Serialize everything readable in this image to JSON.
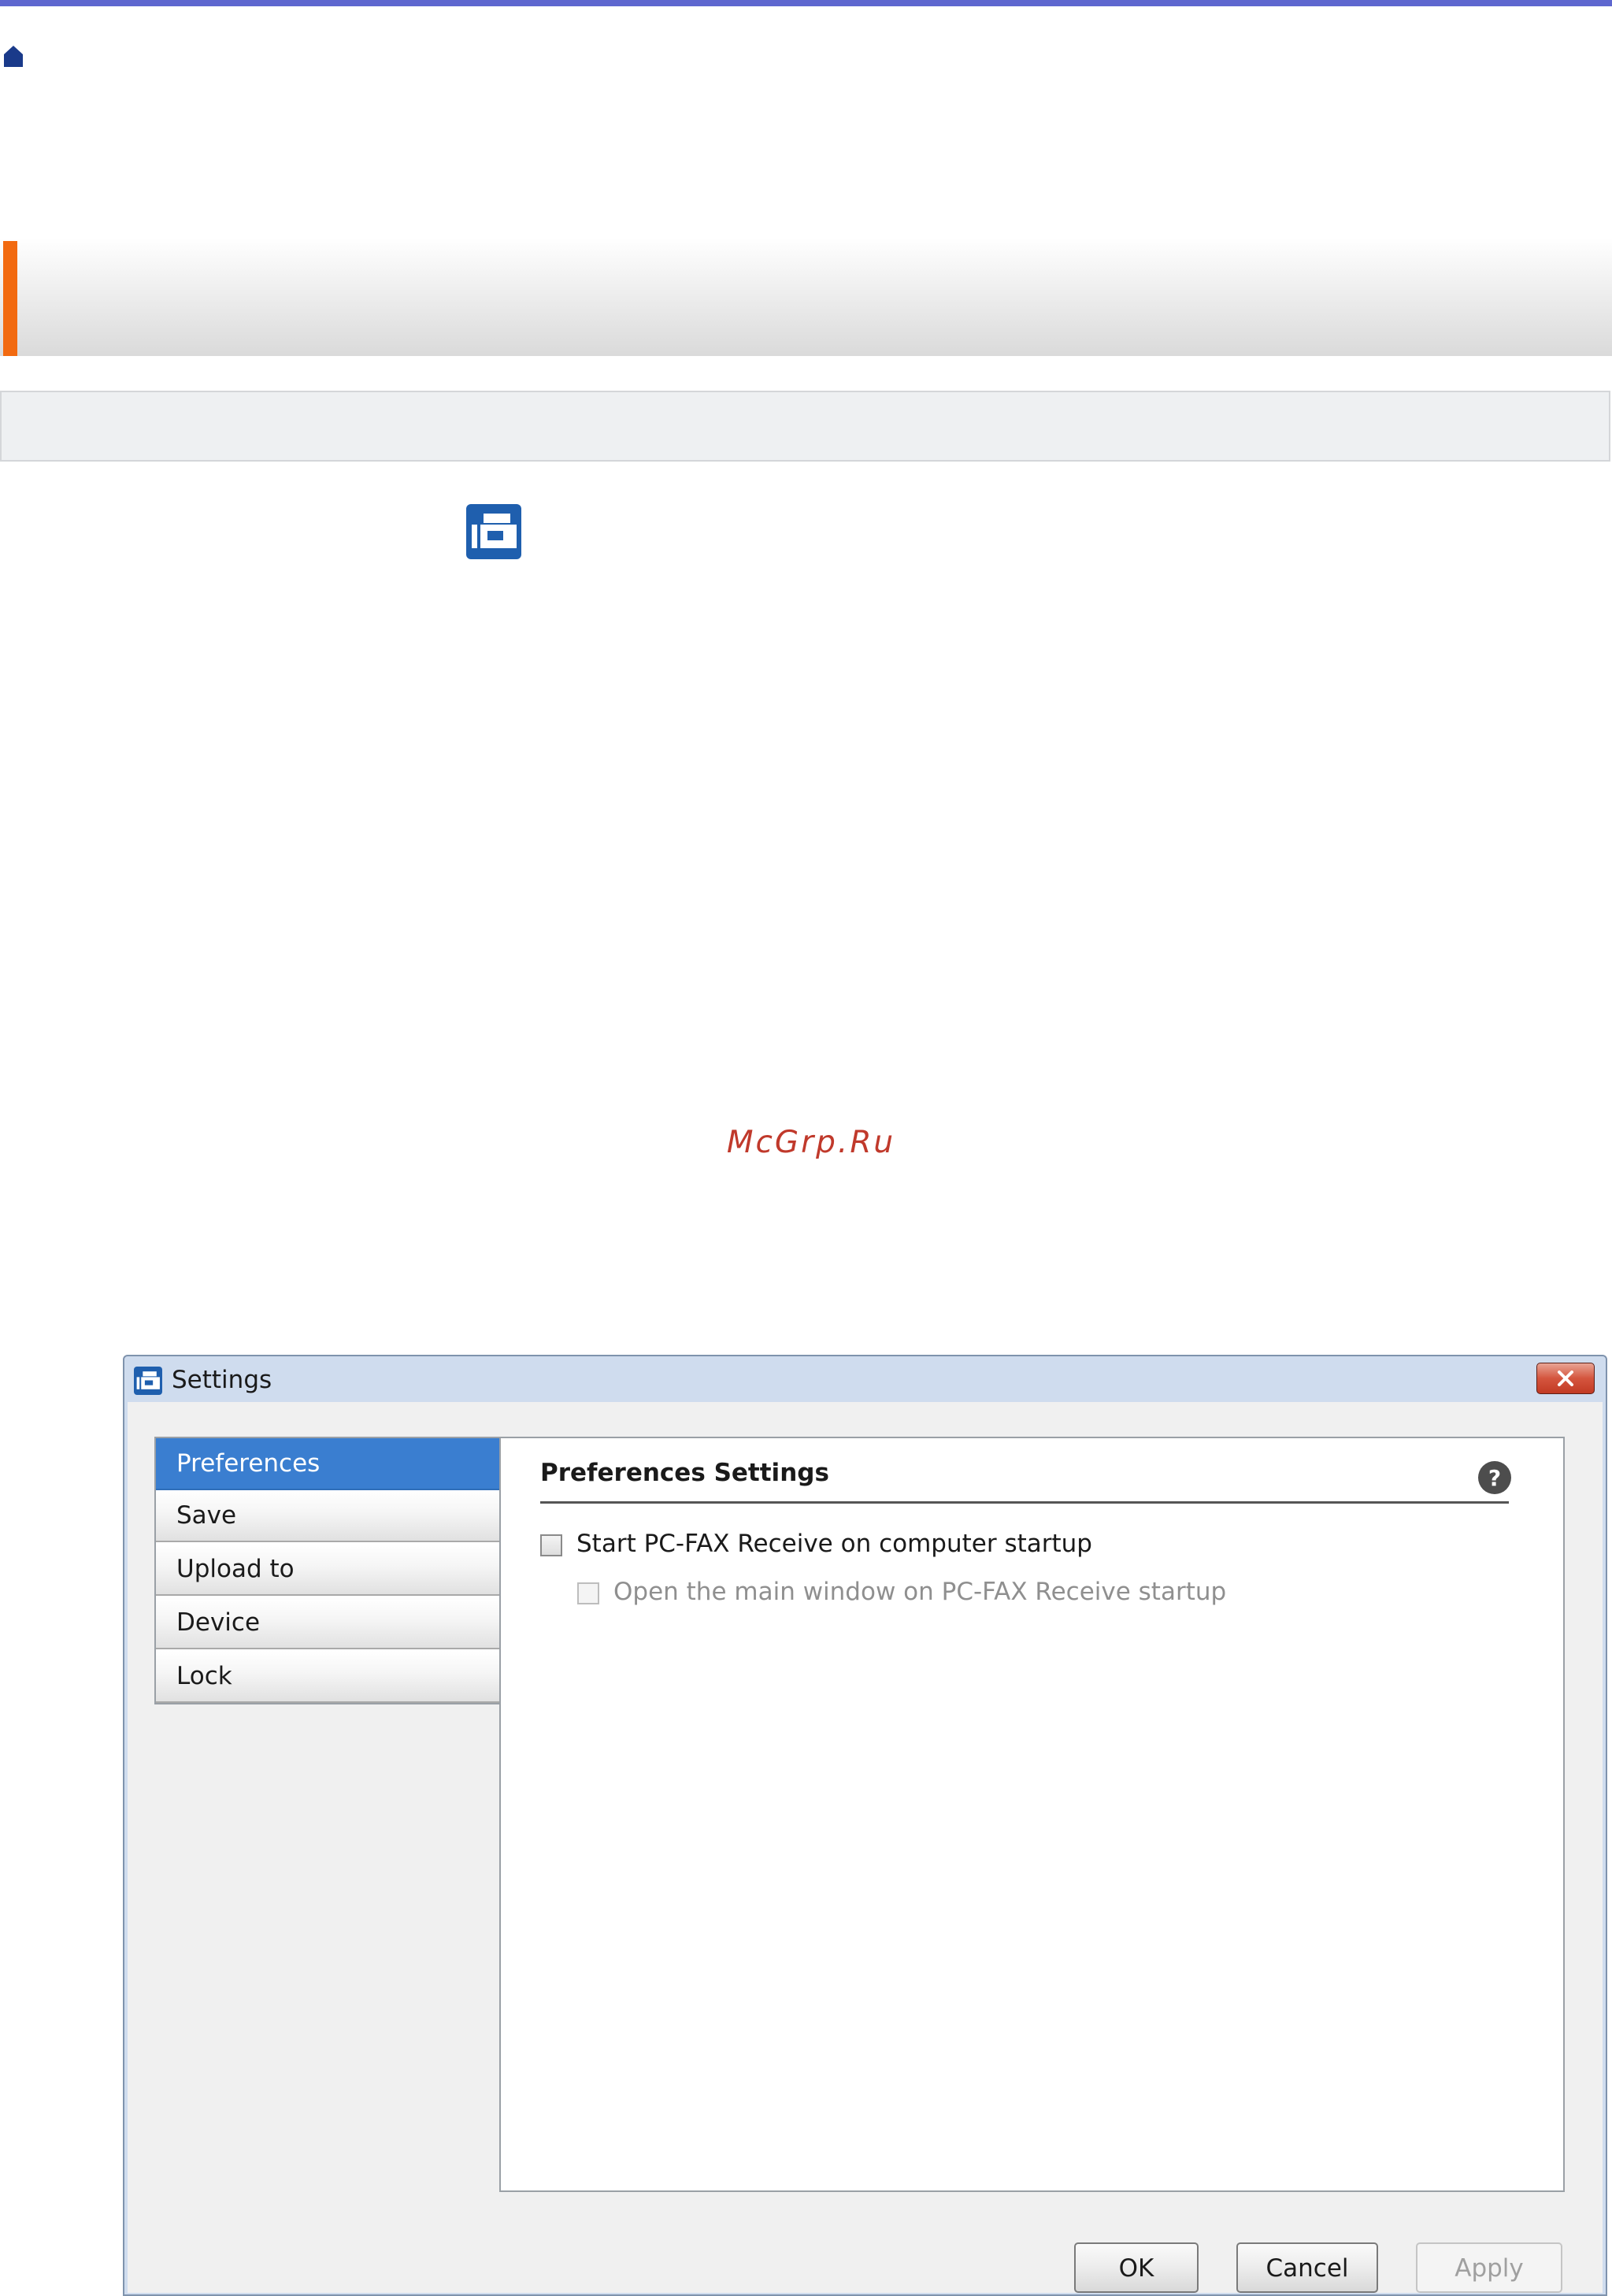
{
  "page": {
    "home_icon": "home-icon",
    "app_icon": "pc-fax-receive-icon",
    "watermark": "McGrp.Ru"
  },
  "dialog": {
    "title": "Settings",
    "title_icon": "pc-fax-receive-icon",
    "close_icon": "close-icon",
    "nav": [
      {
        "label": "Preferences",
        "selected": true
      },
      {
        "label": "Save"
      },
      {
        "label": "Upload to"
      },
      {
        "label": "Device"
      },
      {
        "label": "Lock"
      }
    ],
    "panel": {
      "title": "Preferences Settings",
      "help_icon": "help-icon",
      "options": [
        {
          "label": "Start PC-FAX Receive on computer startup",
          "checked": false,
          "enabled": true
        },
        {
          "label": "Open the main window on PC-FAX Receive startup",
          "checked": false,
          "enabled": false
        }
      ]
    },
    "buttons": {
      "ok": "OK",
      "cancel": "Cancel",
      "apply": "Apply"
    }
  },
  "colors": {
    "accent_bar": "#f26a10",
    "top_rule": "#5e67cf",
    "selected_nav": "#3a7ed0",
    "app_icon": "#1f5fae",
    "watermark": "#c0392b"
  }
}
